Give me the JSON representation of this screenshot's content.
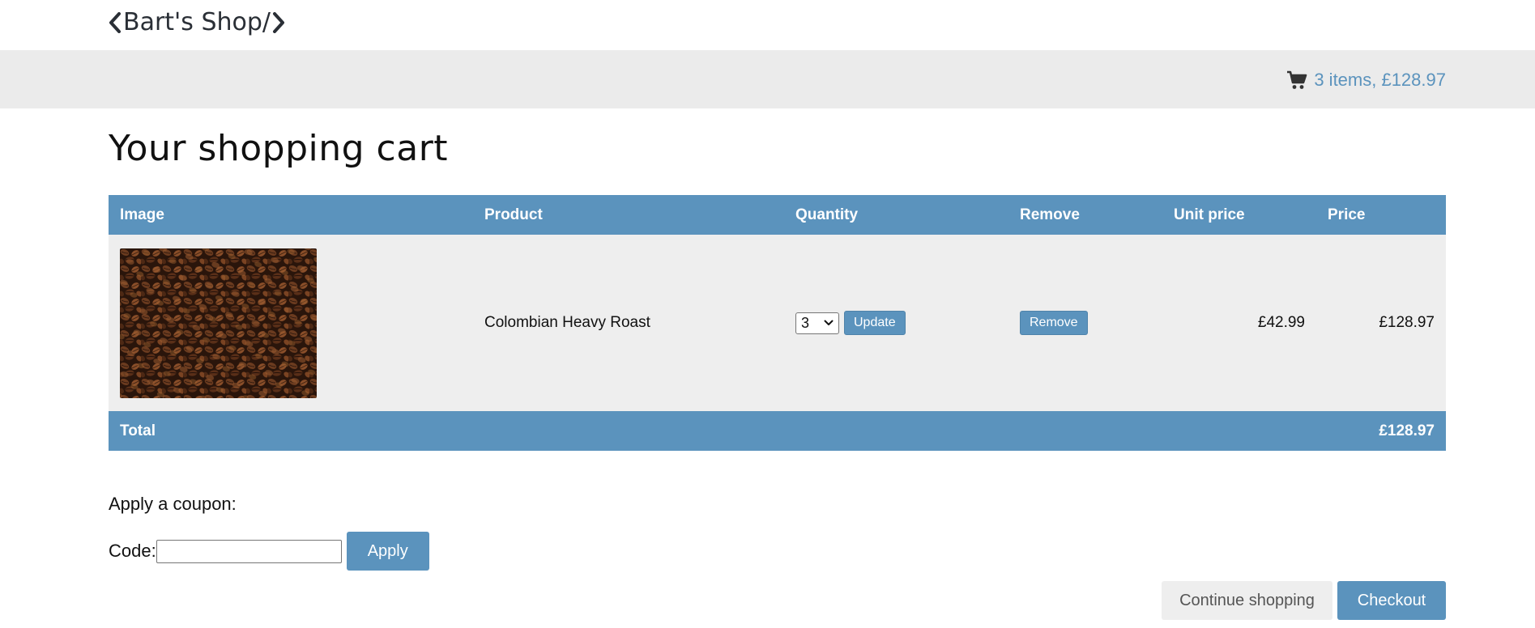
{
  "header": {
    "logo_text": "Bart's Shop/"
  },
  "cart_bar": {
    "summary": "3 items, £128.97",
    "icon": "cart-icon"
  },
  "page": {
    "title": "Your shopping cart"
  },
  "table": {
    "headers": [
      "Image",
      "Product",
      "Quantity",
      "Remove",
      "Unit price",
      "Price"
    ],
    "rows": [
      {
        "product": "Colombian Heavy Roast",
        "quantity": "3",
        "update_label": "Update",
        "remove_label": "Remove",
        "unit_price": "£42.99",
        "price": "£128.97"
      }
    ],
    "total_label": "Total",
    "total_value": "£128.97"
  },
  "coupon": {
    "heading": "Apply a coupon:",
    "code_label": "Code:",
    "code_value": "",
    "apply_label": "Apply"
  },
  "actions": {
    "continue_label": "Continue shopping",
    "checkout_label": "Checkout"
  },
  "colors": {
    "accent": "#5b93bd",
    "bar_background": "#ebebeb",
    "row_background": "#eeeeee"
  }
}
